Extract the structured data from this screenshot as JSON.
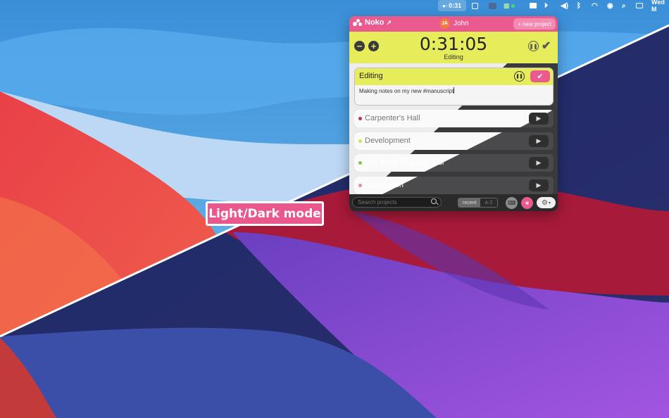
{
  "colors": {
    "brand_pink": "#ea5a8f",
    "timer_yellow": "#e7ec5b",
    "dark_panel": "#3a3a3c"
  },
  "menubar": {
    "timer": "0:31",
    "clock": "Wed M",
    "icons": [
      "noko-icon",
      "square-icon",
      "cloud-icon",
      "stack-icon",
      "monitor-icon",
      "play-circle-icon",
      "volume-icon",
      "bluetooth-icon",
      "wifi-icon",
      "user-circle-icon",
      "search-icon",
      "control-center-icon"
    ]
  },
  "app": {
    "logo": "Noko",
    "user": {
      "initials": "JA",
      "name": "John"
    },
    "new_project": "new project",
    "timer": {
      "value": "0:31:05",
      "label": "Editing"
    },
    "current": {
      "title": "Editing",
      "note": "Making notes on my new #manuscript"
    },
    "projects": [
      {
        "name": "Carpenter's Hall",
        "dot": "#c0305a"
      },
      {
        "name": "Development",
        "dot": "#d8e04a"
      },
      {
        "name": "City Wide Segway Tour",
        "dot": "#8bc34a"
      },
      {
        "name": "Distribution",
        "dot": "#f0899f"
      }
    ],
    "search_placeholder": "Search projects",
    "sort": {
      "recent": "recent",
      "az": "A-Z"
    }
  },
  "overlay": {
    "label": "Light/Dark mode"
  }
}
